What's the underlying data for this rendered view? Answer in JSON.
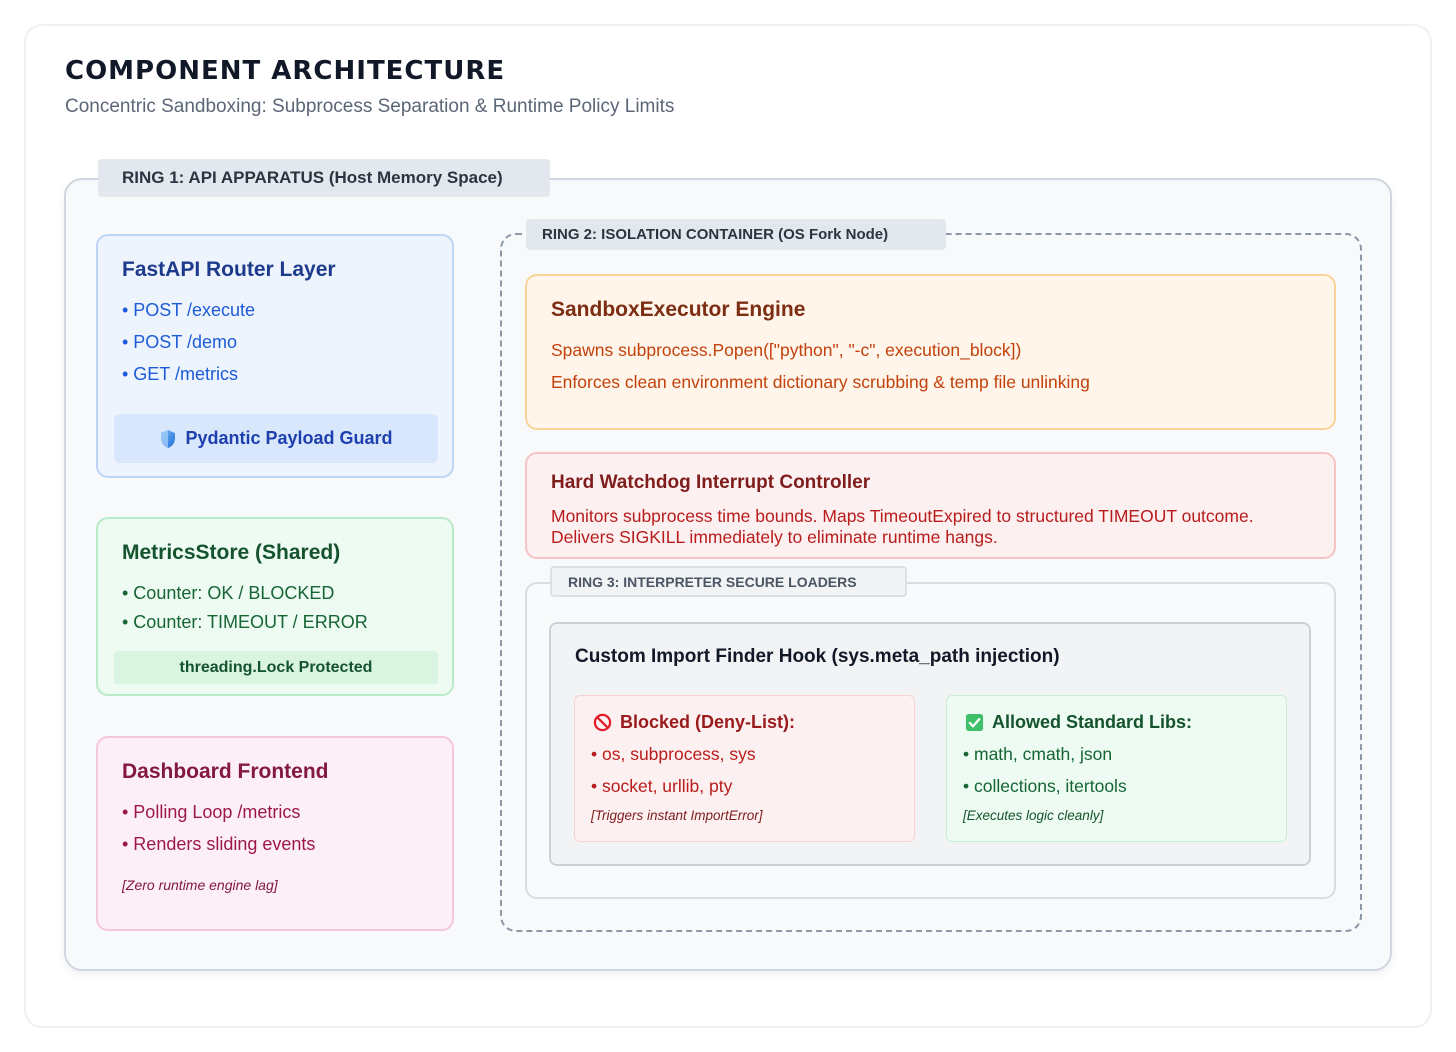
{
  "header": {
    "title": "COMPONENT ARCHITECTURE",
    "subtitle": "Concentric Sandboxing: Subprocess Separation & Runtime Policy Limits"
  },
  "ring1": {
    "label": "RING 1: API APPARATUS (Host Memory Space)",
    "fastapi": {
      "title": "FastAPI Router Layer",
      "items": [
        "• POST /execute",
        "• POST /demo",
        "• GET /metrics"
      ],
      "guard_icon": "shield-icon",
      "guard_label": "Pydantic Payload Guard"
    },
    "metrics": {
      "title": "MetricsStore (Shared)",
      "items": [
        "• Counter: OK / BLOCKED",
        "• Counter: TIMEOUT / ERROR"
      ],
      "lock_label": "threading.Lock Protected"
    },
    "dashboard": {
      "title": "Dashboard Frontend",
      "items": [
        "• Polling Loop /metrics",
        "• Renders sliding events"
      ],
      "note": "[Zero runtime engine lag]"
    }
  },
  "ring2": {
    "label": "RING 2: ISOLATION CONTAINER (OS Fork Node)",
    "sandbox": {
      "title": "SandboxExecutor Engine",
      "lines": [
        "Spawns subprocess.Popen([\"python\", \"-c\", execution_block])",
        "Enforces clean environment dictionary scrubbing & temp file unlinking"
      ]
    },
    "watchdog": {
      "title": "Hard Watchdog Interrupt Controller",
      "description": "Monitors subprocess time bounds. Maps TimeoutExpired to structured TIMEOUT outcome. Delivers SIGKILL immediately to eliminate runtime hangs."
    }
  },
  "ring3": {
    "label": "RING 3: INTERPRETER SECURE LOADERS",
    "finder_title": "Custom Import Finder Hook (sys.meta_path injection)",
    "blocked": {
      "icon": "prohibited-icon",
      "title": "Blocked (Deny-List):",
      "items": [
        "• os, subprocess, sys",
        "• socket, urllib, pty"
      ],
      "note": "[Triggers instant ImportError]"
    },
    "allowed": {
      "icon": "check-box-icon",
      "title": "Allowed Standard Libs:",
      "items": [
        "• math, cmath, json",
        "• collections, itertools"
      ],
      "note": "[Executes logic cleanly]"
    }
  },
  "colors": {
    "fastapi_bg": "#edf4fe",
    "metrics_bg": "#edfbf2",
    "dashboard_bg": "#fcf0f6",
    "sandbox_bg": "#fff5ea",
    "watchdog_bg": "#fdf0f0"
  }
}
